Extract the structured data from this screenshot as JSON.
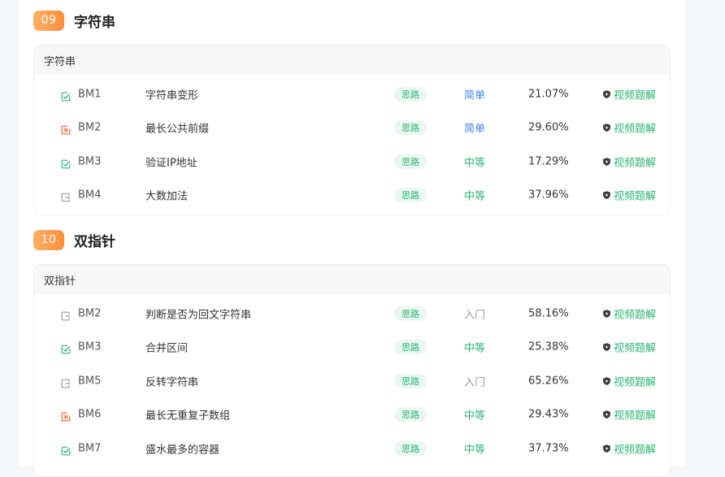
{
  "sections": [
    {
      "number": "09",
      "title": "字符串",
      "card_title": "字符串",
      "rows": [
        {
          "status": "done",
          "code": "BM1",
          "title": "字符串变形",
          "tag": "思路",
          "difficulty": "简单",
          "rate": "21.07%",
          "video": "视频题解"
        },
        {
          "status": "failed",
          "code": "BM2",
          "title": "最长公共前缀",
          "tag": "思路",
          "difficulty": "简单",
          "rate": "29.60%",
          "video": "视频题解"
        },
        {
          "status": "done",
          "code": "BM3",
          "title": "验证IP地址",
          "tag": "思路",
          "difficulty": "中等",
          "rate": "17.29%",
          "video": "视频题解"
        },
        {
          "status": "todo",
          "code": "BM4",
          "title": "大数加法",
          "tag": "思路",
          "difficulty": "中等",
          "rate": "37.96%",
          "video": "视频题解"
        }
      ]
    },
    {
      "number": "10",
      "title": "双指针",
      "card_title": "双指针",
      "rows": [
        {
          "status": "todo",
          "code": "BM2",
          "title": "判断是否为回文字符串",
          "tag": "思路",
          "difficulty": "入门",
          "rate": "58.16%",
          "video": "视频题解"
        },
        {
          "status": "done",
          "code": "BM3",
          "title": "合并区间",
          "tag": "思路",
          "difficulty": "中等",
          "rate": "25.38%",
          "video": "视频题解"
        },
        {
          "status": "todo",
          "code": "BM5",
          "title": "反转字符串",
          "tag": "思路",
          "difficulty": "入门",
          "rate": "65.26%",
          "video": "视频题解"
        },
        {
          "status": "failed",
          "code": "BM6",
          "title": "最长无重复子数组",
          "tag": "思路",
          "difficulty": "中等",
          "rate": "29.43%",
          "video": "视频题解"
        },
        {
          "status": "done",
          "code": "BM7",
          "title": "盛水最多的容器",
          "tag": "思路",
          "difficulty": "中等",
          "rate": "37.73%",
          "video": "视频题解"
        }
      ]
    }
  ],
  "colors": {
    "badge": "#ff9a48",
    "done": "#2bb673",
    "failed": "#f0642d",
    "todo": "#9a9a9a",
    "easy": "#3e86e6",
    "medium": "#2bb673",
    "intro": "#999999",
    "video": "#2bb673"
  },
  "icons": {
    "done": "check-square-icon",
    "failed": "x-square-icon",
    "todo": "open-square-icon",
    "video": "shield-play-icon"
  }
}
